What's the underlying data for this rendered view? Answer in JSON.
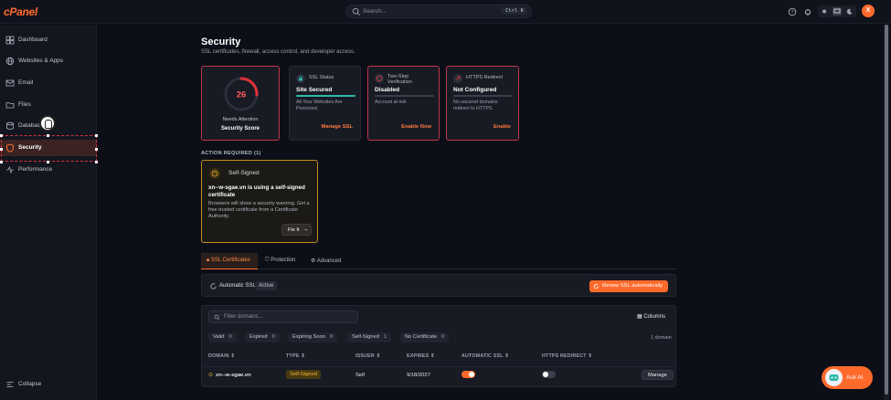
{
  "app": {
    "logo_text": "cPanel",
    "brand_color": "#ff6a2c"
  },
  "topbar": {
    "search_placeholder": "Search...",
    "search_shortcut": "Ctrl K",
    "avatar_initial": "X",
    "icons": [
      "help-icon",
      "bell-icon",
      "theme-light-icon",
      "theme-system-icon",
      "theme-dark-icon"
    ]
  },
  "sidebar": {
    "items": [
      {
        "label": "Dashboard",
        "icon": "dashboard-icon"
      },
      {
        "label": "Websites & Apps",
        "icon": "globe-icon"
      },
      {
        "label": "Email",
        "icon": "mail-icon"
      },
      {
        "label": "Files",
        "icon": "folder-icon"
      },
      {
        "label": "Databases",
        "icon": "database-icon"
      },
      {
        "label": "Security",
        "icon": "shield-icon",
        "active": true
      },
      {
        "label": "Performance",
        "icon": "performance-icon"
      }
    ],
    "collapse_label": "Collapse"
  },
  "page": {
    "title": "Security",
    "subtitle": "SSL certificates, firewall, access control, and developer access."
  },
  "score_card": {
    "score": "26",
    "score_fraction": 0.26,
    "status": "Needs Attention",
    "label": "Security Score"
  },
  "cards": [
    {
      "title": "SSL Status",
      "value": "Site Secured",
      "desc": "All Your Websites Are Protected.",
      "action": "Manage SSL",
      "bar_color": "#2fb8a8"
    },
    {
      "title": "Two-Step Verification",
      "value": "Disabled",
      "desc": "Account at risk",
      "action": "Enable Now",
      "bar_color": "#3a3f4b"
    },
    {
      "title": "HTTPS Redirect",
      "value": "Not Configured",
      "desc": "No secured domains redirect to HTTPS.",
      "action": "Enable",
      "bar_color": "#3a3f4b"
    }
  ],
  "action_required": {
    "section_label": "ACTION REQUIRED (1)",
    "badge": "Self-Signed",
    "title": "xn--w-sgae.vn is using a self-signed certificate",
    "desc": "Browsers will show a security warning. Get a free trusted certificate from a Certificate Authority.",
    "button": "Fix It"
  },
  "tabs": [
    {
      "label": "SSL Certificates",
      "icon": "lock-icon",
      "active": true
    },
    {
      "label": "Protection",
      "icon": "shield-icon"
    },
    {
      "label": "Advanced",
      "icon": "gear-icon"
    }
  ],
  "auto_ssl": {
    "label": "Automatic SSL",
    "status": "Active",
    "button": "Renew SSL automatically"
  },
  "table": {
    "filter_placeholder": "Filter domains...",
    "columns_button": "Columns",
    "count_label": "1 domain",
    "chips": [
      {
        "label": "Valid",
        "count": "0"
      },
      {
        "label": "Expired",
        "count": "0"
      },
      {
        "label": "Expiring Soon",
        "count": "0"
      },
      {
        "label": "Self-Signed",
        "count": "1"
      },
      {
        "label": "No Certificate",
        "count": "0"
      }
    ],
    "headers": [
      "DOMAIN ⇕",
      "TYPE ⇕",
      "ISSUER ⇕",
      "EXPIRES ⇕",
      "AUTOMATIC SSL ⇕",
      "HTTPS REDIRECT ⇕"
    ],
    "rows": [
      {
        "domain": "xn--w-sgae.vn",
        "type": "Self-Signed",
        "issuer": "Self",
        "expires": "9/18/2027",
        "auto_ssl": true,
        "https_redirect": false,
        "action": "Manage"
      }
    ]
  },
  "ask_ai": {
    "label": "Ask AI"
  }
}
